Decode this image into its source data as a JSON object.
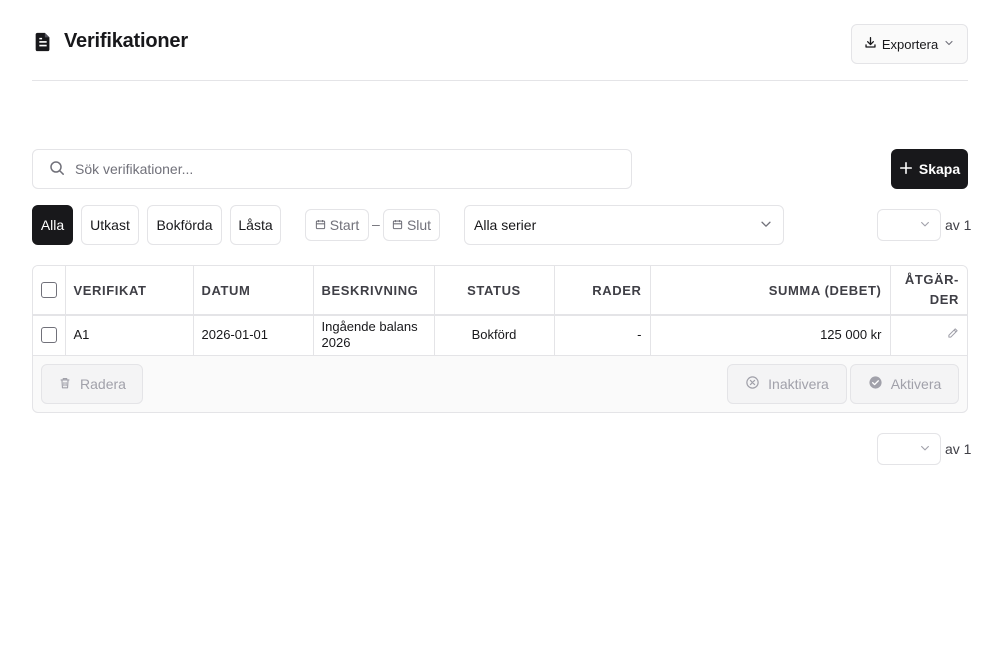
{
  "header": {
    "title": "Verifikationer",
    "export_label": "Exportera"
  },
  "search": {
    "placeholder": "Sök verifikationer...",
    "value": ""
  },
  "create_label": "Skapa",
  "filters": {
    "status_tabs": [
      "Alla",
      "Utkast",
      "Bokförda",
      "Låsta"
    ],
    "active_tab": "Alla",
    "start_label": "Start",
    "date_separator": "–",
    "end_label": "Slut",
    "series_selected": "Alla serier"
  },
  "pagination": {
    "current_page": "",
    "of_label": "av 1"
  },
  "table": {
    "columns": [
      "VERIFIKAT",
      "DATUM",
      "BESKRIVNING",
      "STATUS",
      "RADER",
      "SUMMA (DEBET)",
      "ÅTGÄR-DER"
    ],
    "rows": [
      {
        "verifikat": "A1",
        "datum": "2026-01-01",
        "beskrivning": "Ingående balans 2026",
        "status": "Bokförd",
        "rader": "-",
        "summa": "125 000 kr"
      }
    ]
  },
  "bulk_actions": {
    "delete_label": "Radera",
    "deactivate_label": "Inaktivera",
    "activate_label": "Aktivera"
  },
  "colors": {
    "primary": "#18181b",
    "border": "#e4e4e7",
    "muted_text": "#71717a",
    "disabled_text": "#a1a1aa"
  }
}
